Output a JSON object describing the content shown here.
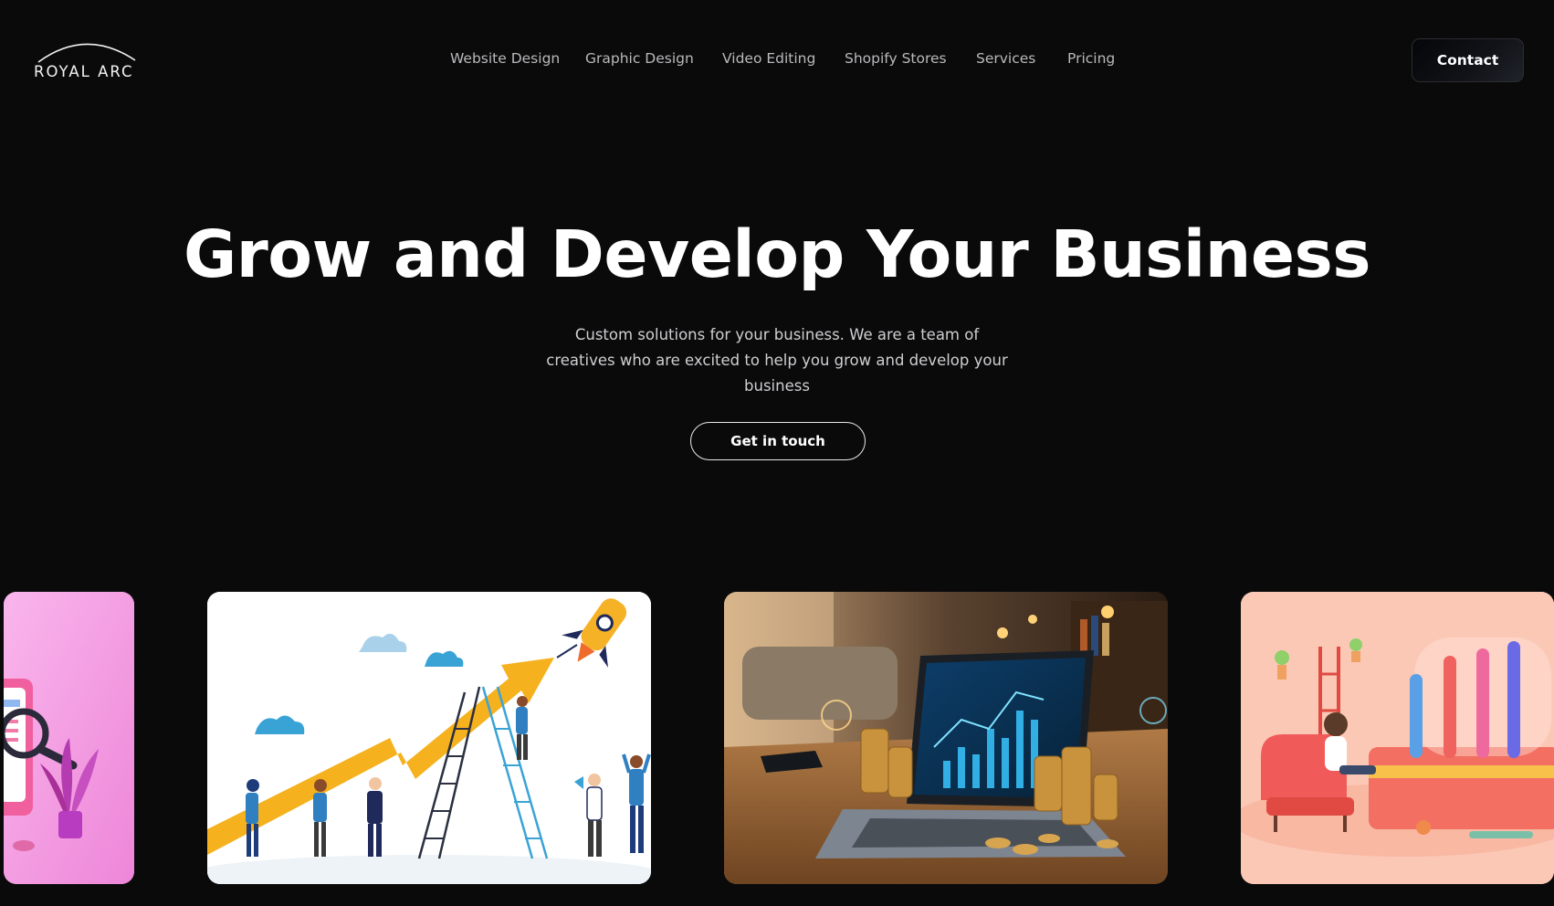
{
  "header": {
    "logo_text": "ROYAL ARC",
    "nav": [
      {
        "label": "Website Design"
      },
      {
        "label": "Graphic Design"
      },
      {
        "label": "Video Editing"
      },
      {
        "label": "Shopify Stores"
      },
      {
        "label": "Services"
      },
      {
        "label": "Pricing"
      }
    ],
    "contact_label": "Contact"
  },
  "hero": {
    "title": "Grow and Develop Your Business",
    "subtitle": "Custom solutions for your business. We are a team of creatives who are excited to help you grow and develop your business",
    "cta_label": "Get in touch"
  },
  "gallery": {
    "images": [
      {
        "subject": "pink-3d-search-illustration"
      },
      {
        "subject": "growth-arrow-team-illustration"
      },
      {
        "subject": "laptop-finance-coins-photo"
      },
      {
        "subject": "3d-bar-chart-room-illustration"
      }
    ]
  },
  "colors": {
    "background": "#0a0a0b",
    "text": "#ffffff",
    "nav_text": "#b9b9bb",
    "arrow_yellow": "#f5b11e"
  }
}
